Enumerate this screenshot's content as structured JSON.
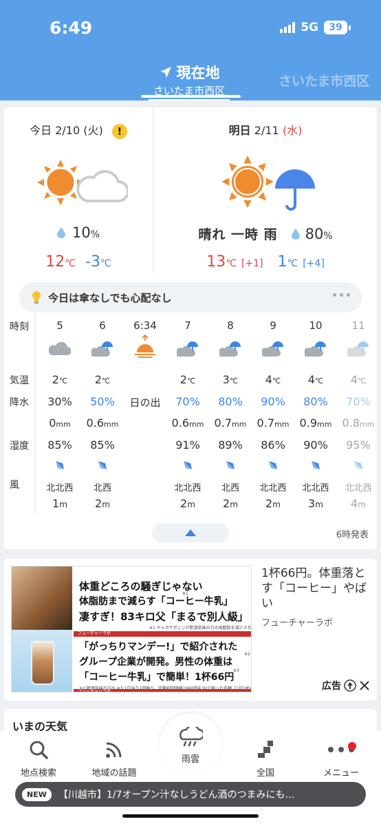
{
  "status_bar": {
    "time": "6:49",
    "network": "5G",
    "battery": "39"
  },
  "location": {
    "label": "現在地",
    "area": "さいたま市西区",
    "next_area": "さいたま市西区"
  },
  "today": {
    "label": "今日",
    "date": "2/10",
    "weekday": "(火)",
    "warning_badge": "!",
    "icon": "sun-cloud-icon",
    "rain_chance": "10",
    "rain_unit": "%",
    "high": "12",
    "low": "-3",
    "temp_unit": "℃"
  },
  "tomorrow": {
    "label": "明日",
    "date": "2/11",
    "weekday": "(水)",
    "icon": "sun-umbrella-icon",
    "condition": "晴れ 一時 雨",
    "rain_chance": "80",
    "rain_unit": "%",
    "high": "13",
    "high_diff": "[+1]",
    "low": "1",
    "low_diff": "[+4]",
    "temp_unit": "℃"
  },
  "tip": {
    "text": "今日は傘なしでも心配なし",
    "more": "•••"
  },
  "hourly_labels": {
    "time": "時刻",
    "temp": "気温",
    "rain": "降水",
    "humidity": "湿度",
    "wind": "風"
  },
  "hourly": [
    {
      "time": "5",
      "icon": "cloud-icon",
      "temp": "2",
      "rain": "30%",
      "mm": "0",
      "humidity": "85%",
      "wind_dir": "北北西",
      "wind_speed": "1"
    },
    {
      "time": "6",
      "icon": "cloud-umbrella-icon",
      "temp": "2",
      "rain": "50%",
      "mm": "0.6",
      "humidity": "85%",
      "wind_dir": "北西",
      "wind_speed": "2"
    },
    {
      "time": "6:34",
      "icon": "sunrise-icon",
      "sunrise_label": "日の出"
    },
    {
      "time": "7",
      "icon": "cloud-umbrella-icon",
      "temp": "2",
      "rain": "70%",
      "mm": "0.6",
      "humidity": "91%",
      "wind_dir": "北北西",
      "wind_speed": "2"
    },
    {
      "time": "8",
      "icon": "cloud-umbrella-icon",
      "temp": "3",
      "rain": "80%",
      "mm": "0.7",
      "humidity": "89%",
      "wind_dir": "北西",
      "wind_speed": "2"
    },
    {
      "time": "9",
      "icon": "cloud-umbrella-icon",
      "temp": "4",
      "rain": "90%",
      "mm": "0.7",
      "humidity": "86%",
      "wind_dir": "北北西",
      "wind_speed": "2"
    },
    {
      "time": "10",
      "icon": "cloud-umbrella-icon",
      "temp": "4",
      "rain": "80%",
      "mm": "0.9",
      "humidity": "90%",
      "wind_dir": "北北西",
      "wind_speed": "3"
    },
    {
      "time": "11",
      "icon": "cloud-umbrella-icon",
      "temp": "4",
      "rain": "70%",
      "mm": "0.8",
      "humidity": "95%",
      "wind_dir": "北北西",
      "wind_speed": "4"
    }
  ],
  "units": {
    "temp": "℃",
    "mm": "mm",
    "speed": "m"
  },
  "updated": "6時発表",
  "ad": {
    "line1": "体重どころの騒ぎじゃない",
    "line2": "体脂肪まで減らす「コーヒー牛乳」",
    "line3": "凄すぎ！83キロ父「まるで別人級」",
    "line4": "「がっちりマンデー!」で紹介された",
    "line5": "グループ企業が開発。男性の体重は",
    "line6": "「コーヒー牛乳」で簡単！1杯66円",
    "brand_bar": "フューチャーラボ",
    "fine1": "※1:チャカサポニンが肥満気味の方の体脂肪を減少させること",
    "fine2": "※2:肥満気味の方の ※3:1日当り1回換り、定期初回価格1980円を30で割った金額（1日1杯※目安）",
    "mark1": "※1",
    "mark2": "※2",
    "mark3": "※3",
    "title": "1杯66円。体重落とす「コーヒー」やばい",
    "source": "フューチャーラボ",
    "label": "広告"
  },
  "now_weather": {
    "title": "いまの天気"
  },
  "nav": {
    "search": "地点検索",
    "topics": "地域の話題",
    "radar": "雨雲",
    "national": "全国",
    "menu": "メニュー"
  },
  "ticker": {
    "badge": "NEW",
    "text": "【川越市】1/7オープン汁なしうどん酒のつまみにも…"
  },
  "colors": {
    "header": "#5aa0e8",
    "red": "#e2453c",
    "blue": "#3d84e6",
    "sun": "#f08c30"
  }
}
